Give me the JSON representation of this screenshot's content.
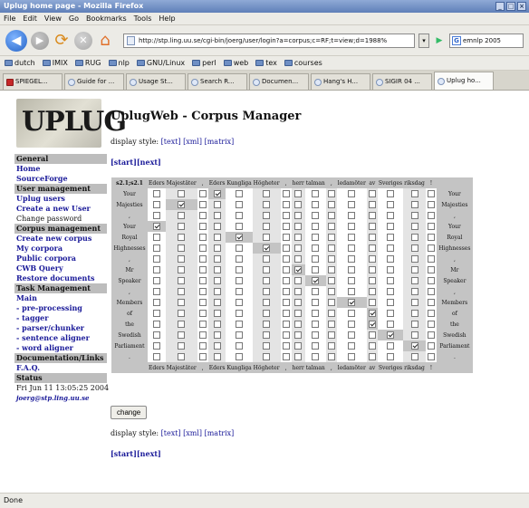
{
  "window": {
    "title": "Uplug home page - Mozilla Firefox"
  },
  "menu": [
    "File",
    "Edit",
    "View",
    "Go",
    "Bookmarks",
    "Tools",
    "Help"
  ],
  "toolbar": {
    "url": "http://stp.ling.uu.se/cgi-bin/joerg/user/login?a=corpus;c=RF;t=view;d=1988%",
    "search_value": "emnlp 2005"
  },
  "bookmarks": [
    "dutch",
    "IMIX",
    "RUG",
    "nlp",
    "GNU/Linux",
    "perl",
    "web",
    "tex",
    "courses"
  ],
  "tabs": [
    {
      "label": "SPIEGEL..."
    },
    {
      "label": "Guide for ..."
    },
    {
      "label": "Usage St..."
    },
    {
      "label": "Search R..."
    },
    {
      "label": "Documen..."
    },
    {
      "label": "Hang's H..."
    },
    {
      "label": "SIGIR 04 ..."
    },
    {
      "label": "Uplug ho..."
    }
  ],
  "logo": {
    "text": "UPLUG"
  },
  "page": {
    "title": "UplugWeb - Corpus Manager",
    "display_label": "display style:",
    "display_text": "[text]",
    "display_xml": "[xml]",
    "display_matrix": "[matrix]",
    "nav_start": "[start]",
    "nav_next": "[next]",
    "change_button": "change"
  },
  "sidebar": [
    {
      "type": "head",
      "text": "General"
    },
    {
      "type": "link",
      "text": "Home"
    },
    {
      "type": "link",
      "text": "SourceForge"
    },
    {
      "type": "head",
      "text": "User management"
    },
    {
      "type": "link",
      "text": "Uplug users"
    },
    {
      "type": "link",
      "text": "Create a new User"
    },
    {
      "type": "text",
      "text": "Change password"
    },
    {
      "type": "head",
      "text": "Corpus management"
    },
    {
      "type": "link",
      "text": "Create new corpus"
    },
    {
      "type": "link",
      "text": "My corpora"
    },
    {
      "type": "link",
      "text": "Public corpora"
    },
    {
      "type": "link",
      "text": "CWB Query"
    },
    {
      "type": "link",
      "text": "Restore documents"
    },
    {
      "type": "head",
      "text": "Task Management"
    },
    {
      "type": "link",
      "text": "Main"
    },
    {
      "type": "link",
      "text": "- pre-processing"
    },
    {
      "type": "link",
      "text": "- tagger"
    },
    {
      "type": "link",
      "text": "- parser/chunker"
    },
    {
      "type": "link",
      "text": "- sentence aligner"
    },
    {
      "type": "link",
      "text": "- word aligner"
    },
    {
      "type": "head",
      "text": "Documentation/Links"
    },
    {
      "type": "link",
      "text": "F.A.Q."
    },
    {
      "type": "head",
      "text": "Status"
    },
    {
      "type": "text",
      "text": "Fri Jun 11 13:05:25 2004"
    },
    {
      "type": "italic",
      "text": "joerg@stp.ling.uu.se"
    }
  ],
  "matrix": {
    "corner": "s2.1;s2.1",
    "cols": [
      "Eders",
      "Majestäter",
      ",",
      "Eders",
      "Kungliga",
      "Högheter",
      ",",
      "herr",
      "talman",
      ",",
      "ledamöter",
      "av",
      "Sveriges",
      "riksdag",
      "!"
    ],
    "rows": [
      "Your",
      "Majesties",
      ",",
      "Your",
      "Royal",
      "Highnesses",
      ",",
      "Mr",
      "Speaker",
      ",",
      "Members",
      "of",
      "the",
      "Swedish",
      "Parliament",
      "."
    ],
    "checked": [
      [
        0,
        3
      ],
      [
        1,
        1
      ],
      [
        3,
        0
      ],
      [
        4,
        4
      ],
      [
        5,
        5
      ],
      [
        7,
        7
      ],
      [
        8,
        8
      ],
      [
        10,
        10
      ],
      [
        11,
        11
      ],
      [
        12,
        11
      ],
      [
        13,
        12
      ],
      [
        14,
        13
      ]
    ],
    "highlight": [
      [
        0,
        3
      ],
      [
        1,
        1
      ],
      [
        3,
        0
      ],
      [
        4,
        4
      ],
      [
        5,
        5
      ],
      [
        7,
        7
      ],
      [
        8,
        8
      ],
      [
        10,
        10
      ],
      [
        11,
        11
      ],
      [
        12,
        11
      ],
      [
        13,
        12
      ],
      [
        14,
        13
      ]
    ]
  },
  "status": {
    "text": "Done"
  }
}
